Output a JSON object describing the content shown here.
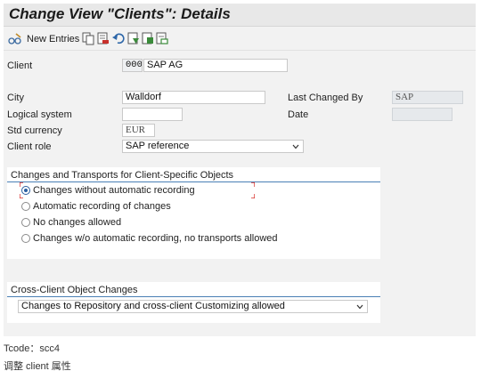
{
  "window": {
    "title": "Change View \"Clients\": Details"
  },
  "toolbar": {
    "new_entries_label": "New Entries",
    "icons": [
      "glasses-edit-icon",
      "copy-icon",
      "delete-icon",
      "undo-icon",
      "select-all-icon",
      "select-block-icon",
      "deselect-all-icon"
    ]
  },
  "form": {
    "client_label": "Client",
    "client_number": "000",
    "client_name": "SAP AG",
    "city_label": "City",
    "city_value": "Walldorf",
    "last_changed_by_label": "Last Changed By",
    "last_changed_by_value": "SAP",
    "logical_system_label": "Logical system",
    "logical_system_value": "",
    "date_label": "Date",
    "date_value": "",
    "std_currency_label": "Std currency",
    "std_currency_value": "EUR",
    "client_role_label": "Client role",
    "client_role_value": "SAP reference"
  },
  "changes_group": {
    "title": "Changes and Transports for Client-Specific Objects",
    "options": [
      "Changes without automatic recording",
      "Automatic recording of changes",
      "No changes allowed",
      "Changes w/o automatic recording, no transports allowed"
    ],
    "selected_index": 0
  },
  "cross_client_group": {
    "title": "Cross-Client Object Changes",
    "value": "Changes to Repository and cross-client Customizing allowed"
  },
  "caption": {
    "tcode_line": "Tcode：scc4",
    "description": "调整 client 属性"
  },
  "colors": {
    "window_bg": "#f2f2f2",
    "group_rule": "#4a7fb5",
    "radio_selected": "#2b5fa0",
    "focus_marker": "#d9302c"
  }
}
